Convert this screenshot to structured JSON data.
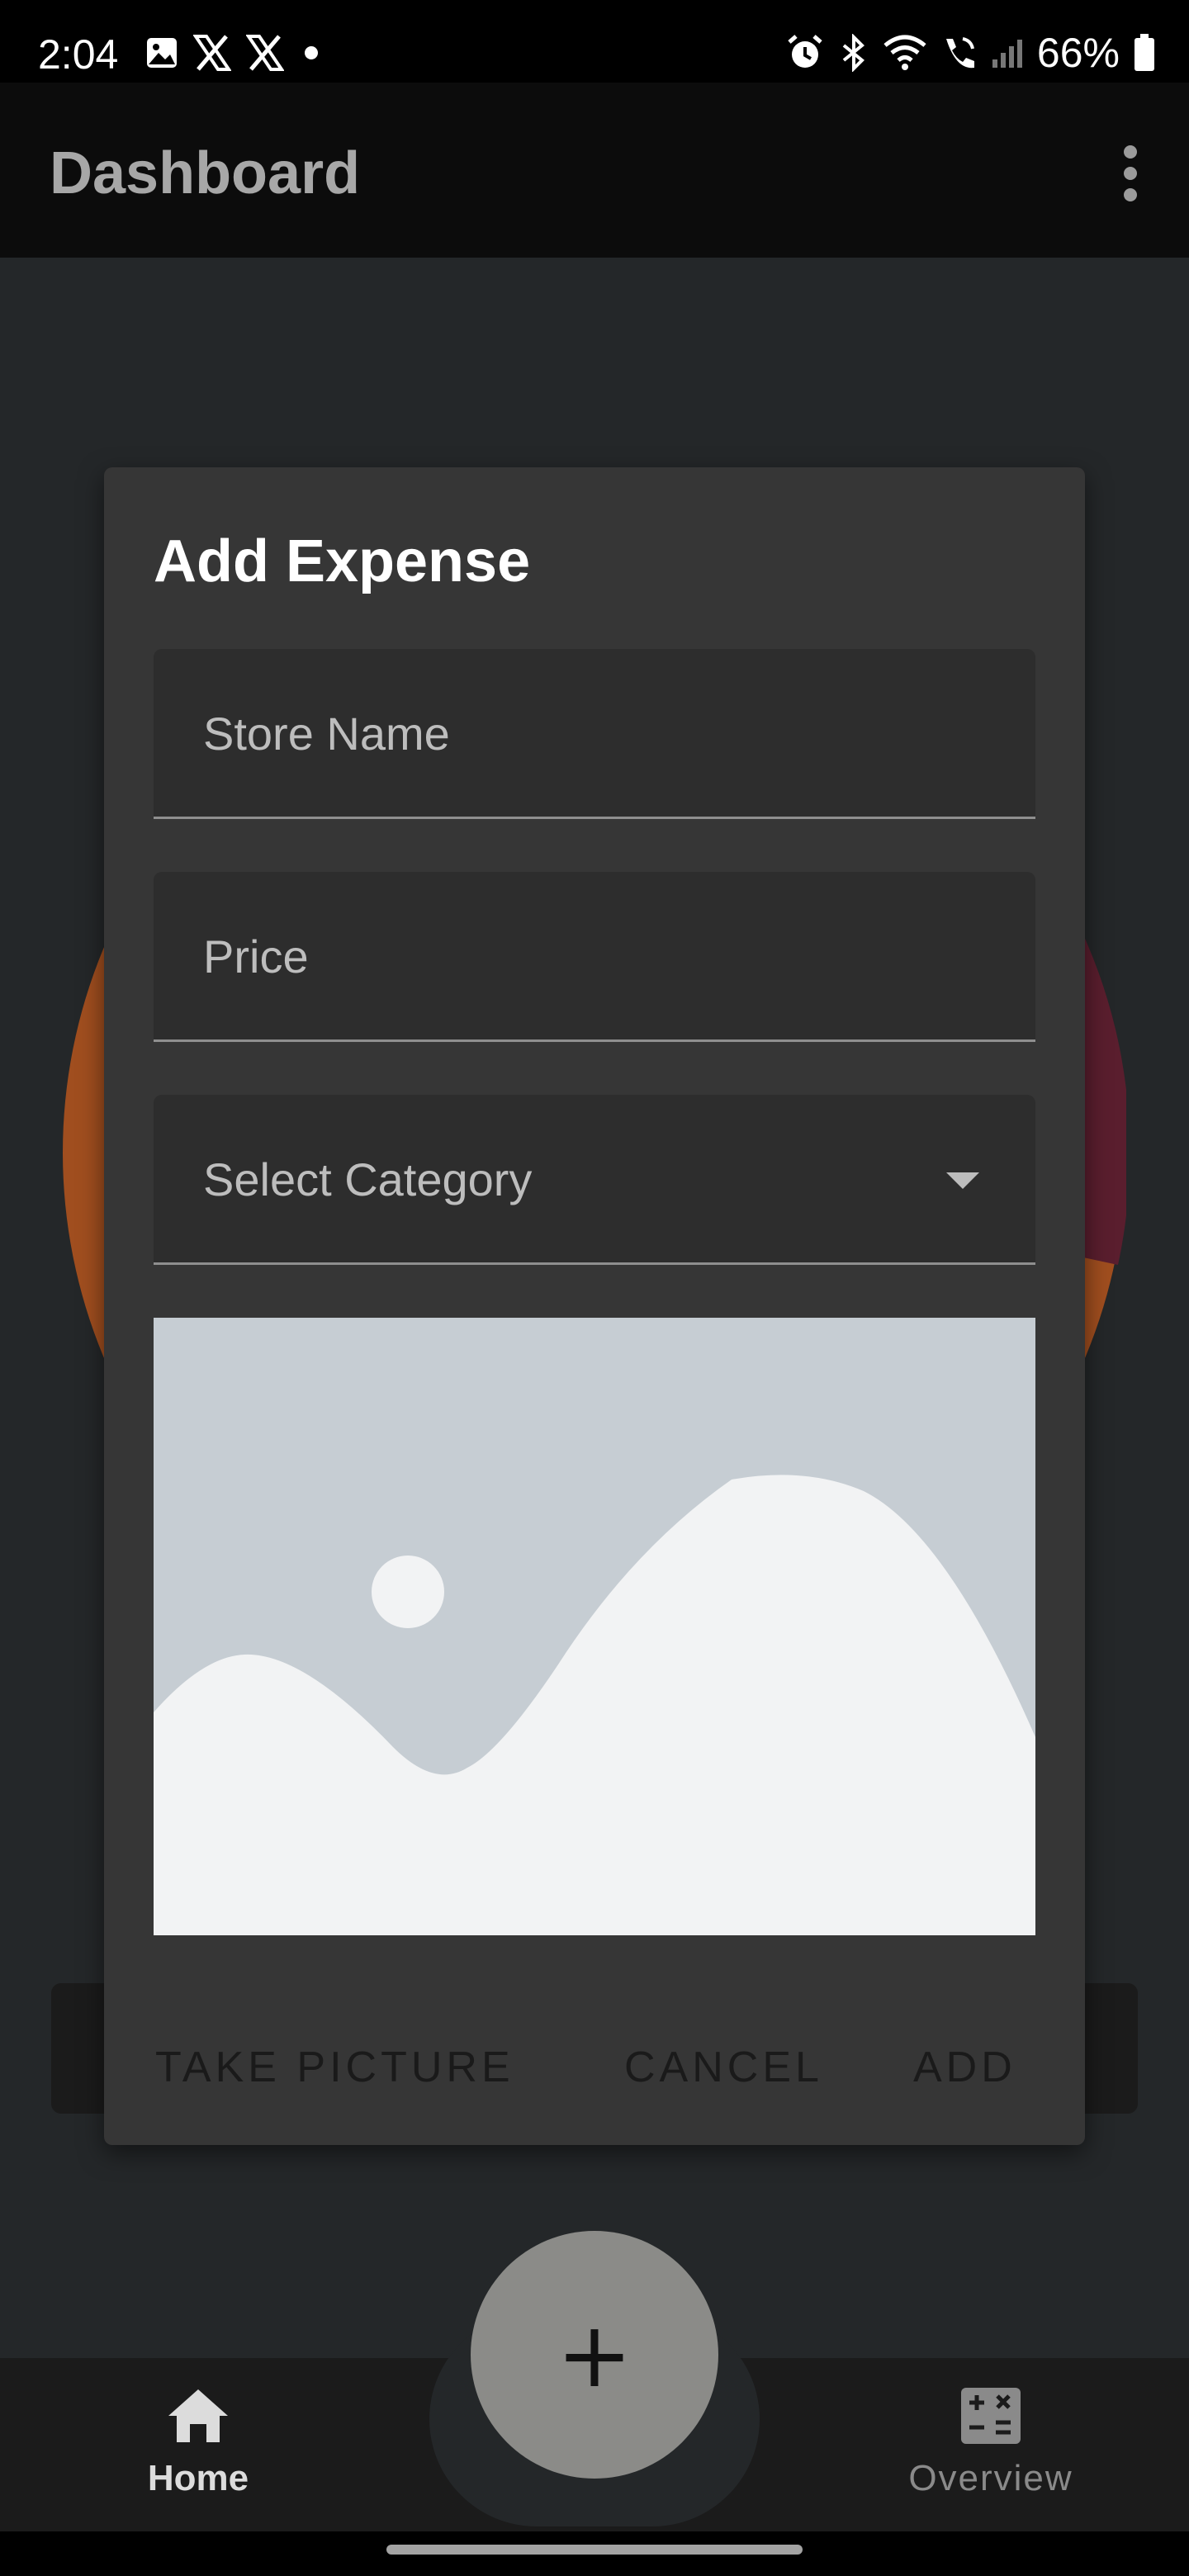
{
  "status_bar": {
    "time": "2:04",
    "battery": "66%",
    "icons": [
      "image-icon",
      "x-icon",
      "x-icon",
      "dot-icon",
      "alarm-icon",
      "bluetooth-icon",
      "wifi-icon",
      "wifi-call-icon",
      "signal-icon",
      "battery-icon"
    ]
  },
  "app_bar": {
    "title": "Dashboard",
    "menu_icon": "more-vert-icon"
  },
  "dialog": {
    "title": "Add Expense",
    "fields": {
      "store_name": {
        "placeholder": "Store Name",
        "value": ""
      },
      "price": {
        "placeholder": "Price",
        "value": ""
      },
      "category": {
        "placeholder": "Select Category",
        "value": ""
      }
    },
    "image_placeholder_icon": "image-placeholder-icon",
    "actions": {
      "take_picture": "TAKE PICTURE",
      "cancel": "CANCEL",
      "add": "ADD"
    }
  },
  "fab": {
    "label": "+"
  },
  "bottom_nav": {
    "items": [
      {
        "label": "Home",
        "icon": "home-icon",
        "active": true
      },
      {
        "label": "Overview",
        "icon": "calculator-icon",
        "active": false
      }
    ]
  },
  "colors": {
    "background": "#242729",
    "dialog": "#363636",
    "field": "#2d2d2d",
    "pie_orange": "#a04e1f",
    "pie_red": "#5a1e2e"
  }
}
